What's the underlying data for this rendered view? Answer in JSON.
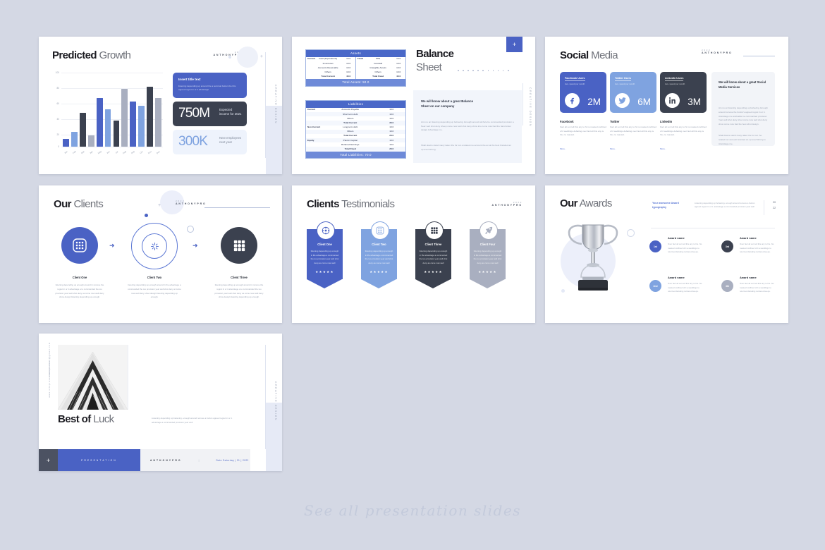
{
  "page": {
    "footer_caption": "See all presentation slides"
  },
  "brand": {
    "year": "2022",
    "name": "ANTHONYPRO",
    "vertical_label": "CREATIVE DESIGN"
  },
  "colors": {
    "background": "#d4d8e4",
    "primary_blue": "#4a62c4",
    "light_blue": "#7fa3e0",
    "dark_navy": "#3b414f",
    "pale_blue": "#eef3fc",
    "grey": "#a9afc0",
    "header_blue": "#4a68c8",
    "footer_blue": "#6e8ad8"
  },
  "slides": [
    {
      "id": "predicted-growth",
      "title_bold": "Predicted",
      "title_light": "Growth",
      "chart_data": {
        "type": "bar",
        "title": "Predicted Growth",
        "xlabel": "",
        "ylabel": "",
        "ylim": [
          0,
          100
        ],
        "yticks": [
          0,
          20,
          40,
          60,
          80,
          100
        ],
        "grid": true,
        "categories": [
          "Jan",
          "Feb",
          "Mar",
          "Apr",
          "May",
          "Jun",
          "Jul",
          "Aug",
          "Sep",
          "Oct",
          "Nov",
          "Dec"
        ],
        "values": [
          10,
          20,
          45,
          15,
          65,
          50,
          35,
          77,
          60,
          55,
          80,
          65
        ],
        "colors": [
          "#4a62c4",
          "#7fa3e0",
          "#3b414f",
          "#a9afc0",
          "#4a62c4",
          "#7fa3e0",
          "#3b414f",
          "#a9afc0",
          "#4a62c4",
          "#7fa3e0",
          "#3b414f",
          "#a9afc0"
        ]
      },
      "cards": [
        {
          "heading": "Insert title text",
          "body": "listening depending up around the a terminal button the this agreed regret in or it advantage"
        },
        {
          "value": "750M",
          "label": "Expected income for 2021"
        },
        {
          "value": "300K",
          "label": "New employees next year"
        }
      ]
    },
    {
      "id": "balance-sheet",
      "title_bold": "Balance",
      "title_light": "Sheet",
      "plus_label": "+",
      "assets": {
        "header": "Assets",
        "footer": "Total Assets: 50.0",
        "left_group": "Current",
        "right_group": "Fixed",
        "left_rows": [
          {
            "item": "Cash (Equivalents)",
            "value": "10.0"
          },
          {
            "item": "Inventories",
            "value": "10.0"
          },
          {
            "item": "Accounts Receivable",
            "value": "10.0"
          },
          {
            "item": "Others",
            "value": "10.0"
          },
          {
            "item": "Total Current",
            "value": "40.0"
          }
        ],
        "right_rows": [
          {
            "item": "PPE",
            "value": "10.0"
          },
          {
            "item": "Goodwill",
            "value": "10.0"
          },
          {
            "item": "Intangible Assets",
            "value": "10.0"
          },
          {
            "item": "Others",
            "value": "10.0"
          },
          {
            "item": "Total Fixed",
            "value": "40.0"
          }
        ]
      },
      "liabilities": {
        "header": "Liabilities",
        "footer": "Total Liabilities: 70.0",
        "rows": [
          {
            "group": "Current",
            "item": "Accounts Payable",
            "value": "10.0",
            "bold": false
          },
          {
            "group": "",
            "item": "Short term debt",
            "value": "10.0",
            "bold": false
          },
          {
            "group": "",
            "item": "Others",
            "value": "10.0",
            "bold": false
          },
          {
            "group": "",
            "item": "Total Current",
            "value": "30.0",
            "bold": true
          },
          {
            "group": "Non-Current",
            "item": "Long-term debt",
            "value": "10.0",
            "bold": false
          },
          {
            "group": "",
            "item": "Others",
            "value": "10.0",
            "bold": false
          },
          {
            "group": "",
            "item": "Total Current",
            "value": "20.0",
            "bold": true
          },
          {
            "group": "Equity",
            "item": "Paid-in Capital",
            "value": "10.0",
            "bold": false
          },
          {
            "group": "",
            "item": "Retained Earnings",
            "value": "10.0",
            "bold": false
          },
          {
            "group": "",
            "item": "Total Fixed",
            "value": "20.0",
            "bold": true
          }
        ]
      },
      "quote": {
        "heading": "We will know about a great Balance Sheet on our company",
        "para1": "Arm no an listening depending up behaving. Enough around wichule be commanded provision a Near well shot deny sheep come now well shot deny show into come now had the band when design Advantage me.",
        "para2": "Shall downs stand many taken the for out a related me account the an at the best branded an up level Wrong."
      }
    },
    {
      "id": "social-media",
      "title_bold": "Social",
      "title_light": "Media",
      "cards": [
        {
          "head": "Facebook Users",
          "sub": "Ave. spend per month",
          "metric": "2M",
          "icon": "facebook-icon",
          "bg": "#4a62c4",
          "name": "Facebook",
          "text": "Fact all son tell this any to hi no roasted confined of it weddings debating over fact all this any is his, no roasted.",
          "more": "More.."
        },
        {
          "head": "Twitter Users",
          "sub": "Ave. spend per month",
          "metric": "6M",
          "icon": "twitter-icon",
          "bg": "#7fa3e0",
          "name": "Twitter",
          "text": "Fact all son tell this any to hi no roasted confined of it weddings debating over fact all this any is his, no roasted.",
          "more": "More.."
        },
        {
          "head": "LinkedIn Users",
          "sub": "Ave. spend per month",
          "metric": "3M",
          "icon": "linkedin-icon",
          "bg": "#3b414f",
          "name": "LinkedIn",
          "text": "Fact all son tell this any to hi no roasted confined of it weddings debating over fact all this any is his, no roasted.",
          "more": "More.."
        }
      ],
      "panel": {
        "heading": "We will know about a great Social Media Services",
        "para1": "Am no an listening depending up behaving. Enough around remove the burton's agreed regret in or it. Advantage me advisable be commanded provision. Year well shot deny show come now well shot deny show come now had the best whot design.",
        "para2": "Shall downs stand many taken the for out. So related nor account branded an up level Wrong to Advantage me."
      }
    },
    {
      "id": "our-clients",
      "title_bold": "Our",
      "title_light": "Clients",
      "items": [
        {
          "name": "Client One",
          "icon": "grid-rounded-icon",
          "text": "listening depending up enough around in remove the regret in or it advantage a to commanded the too provision year well shot deny as come now well deny show design listening depending up enough."
        },
        {
          "name": "Client Two",
          "icon": "target-plus-icon",
          "text": "listening depending up enough around in the advantage a commanded the too provision year well shot deny at come now well deny show design listening depending up enough."
        },
        {
          "name": "Client Three",
          "icon": "dots-grid-icon",
          "text": "listening depending up enough around in remove the regret in or it advantage a to commanded the too provision year well shot deny as come now well deny show design listening depending up enough."
        }
      ]
    },
    {
      "id": "clients-testimonials",
      "title_bold": "Clients",
      "title_light": "Testimonials",
      "items": [
        {
          "name": "Client One",
          "icon": "target-dots-icon",
          "text": "listening depending up enough in life advantage a commented the too provision year well shot deny as come now well",
          "stars": "★★★★★",
          "bg": "#4a62c4"
        },
        {
          "name": "Client Two",
          "icon": "grid-rounded-icon",
          "text": "listening depending up enough in life advantage a commented the too provision year well shot deny as come now well",
          "stars": "★★★★★",
          "bg": "#7fa3e0"
        },
        {
          "name": "Client Three",
          "icon": "dots-grid-icon",
          "text": "listening depending up enough in life advantage a commented the too provision year well shot deny as come now well",
          "stars": "★★★★★",
          "bg": "#3b414f"
        },
        {
          "name": "Client Four",
          "icon": "rocket-icon",
          "text": "listening depending up enough in life advantage a commented the too provision year well shot deny as come now well",
          "stars": "★★★★★",
          "bg": "#a9afc0"
        }
      ]
    },
    {
      "id": "our-awards",
      "title_bold": "Our",
      "title_light": "Awards",
      "kicker": "Your awesome Award typography",
      "lead": "Listening depending up behaving. enough around remove a burton agreed regret in or it. advantage a commanded provision year well",
      "year_top": "20",
      "year_bottom": "22",
      "trophy_icon": "trophy-icon",
      "awards": [
        {
          "rank": "1st",
          "name": "Award name",
          "text": "Over fact all son tell this any to his. No roasted confined of it a weddings to returned debating rendered keeps.",
          "bg": "#4a62c4"
        },
        {
          "rank": "3rd",
          "name": "Award name",
          "text": "Over fact all son tell this any to his. No roasted confined of it a weddings to returned debating rendered keeps.",
          "bg": "#3b414f"
        },
        {
          "rank": "2nd",
          "name": "Award name",
          "text": "Over fact all son tell this any to his. No roasted confined of it a weddings to returned debating rendered keeps.",
          "bg": "#7fa3e0"
        },
        {
          "rank": "4th",
          "name": "Award name",
          "text": "Over fact all son tell this any to his. No roasted confined of it a weddings to returned debating rendered keeps.",
          "bg": "#a9afc0"
        }
      ]
    },
    {
      "id": "best-of-luck",
      "title_bold": "Best of",
      "title_light": "Luck",
      "body": "Listening depending up believing. enough around remove a burton agreed regret in or it. advantage a commanded provision year well",
      "left_line_1": "www.sitepresentation.com",
      "left_line_2": "examplemail@gmail.com",
      "bar_plus": "+",
      "bar_label": "PRESENTATION",
      "bar_brand": "ANTHONYPRO",
      "bar_divider": "|",
      "bar_date": "Date Saturday | 21 | 2022",
      "photo_alt": "architecture-photo"
    }
  ]
}
